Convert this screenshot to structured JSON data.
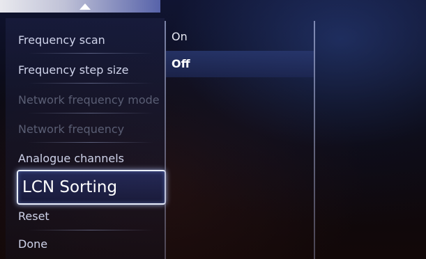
{
  "menu": {
    "items": [
      {
        "label": "Frequency scan",
        "state": "normal"
      },
      {
        "label": "Frequency step size",
        "state": "normal"
      },
      {
        "label": "Network frequency mode",
        "state": "disabled"
      },
      {
        "label": "Network frequency",
        "state": "disabled"
      },
      {
        "label": "Analogue channels",
        "state": "normal"
      },
      {
        "label": "LCN Sorting",
        "state": "selected"
      },
      {
        "label": "Reset",
        "state": "normal"
      },
      {
        "label": "Done",
        "state": "normal"
      }
    ]
  },
  "options": {
    "items": [
      {
        "label": "On",
        "highlighted": false
      },
      {
        "label": "Off",
        "highlighted": true
      }
    ]
  },
  "icons": {
    "scroll_up": "scroll-up-arrow-icon"
  },
  "colors": {
    "selection_border": "#e8eefc",
    "highlight_bg": "#283770",
    "text": "#cfd3ea",
    "disabled_text": "#5a5e74"
  }
}
